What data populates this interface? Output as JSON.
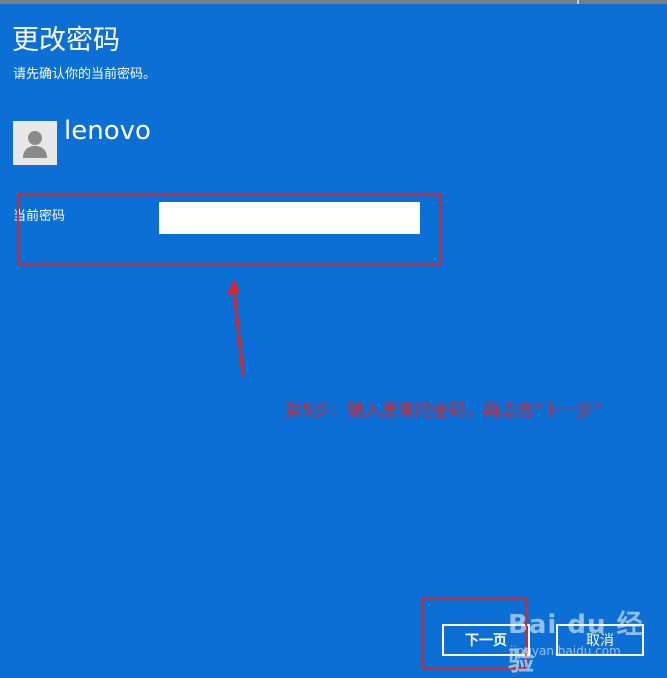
{
  "dialog": {
    "title": "更改密码",
    "subtitle": "请先确认你的当前密码。"
  },
  "account": {
    "username": "lenovo",
    "avatar_icon": "user-silhouette-icon"
  },
  "form": {
    "current_password_label": "当前密码",
    "current_password_value": ""
  },
  "buttons": {
    "next_label": "下一页",
    "cancel_label": "取消"
  },
  "annotation": {
    "text": "第5步：输入原来的密码，再点击“下一步”",
    "color": "#d9262b"
  },
  "watermark": {
    "brand": "Bai du 经验",
    "url": "jingyan.baidu.com"
  },
  "colors": {
    "background": "#0b6fd6",
    "highlight": "#d9262b"
  }
}
